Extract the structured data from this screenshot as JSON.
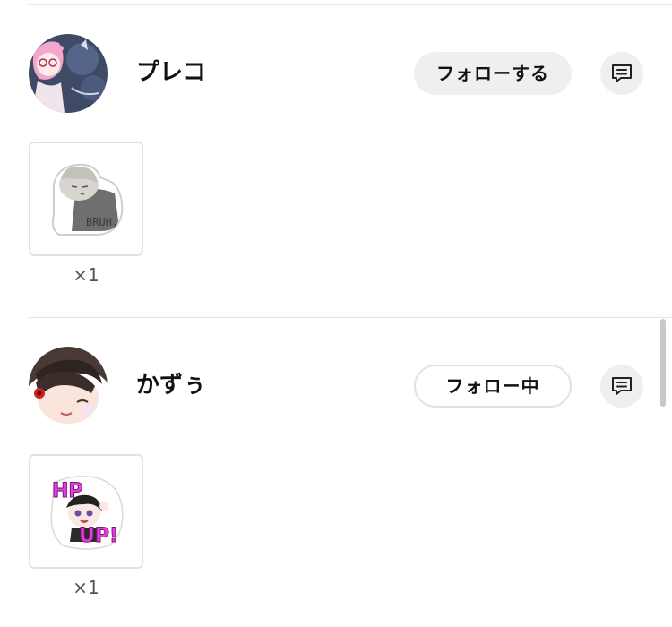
{
  "users": [
    {
      "name": "プレコ",
      "follow_label": "フォローする",
      "follow_state": "not-following",
      "sticker_count": "×1",
      "sticker_icon": "bruh-sticker"
    },
    {
      "name": "かずぅ",
      "follow_label": "フォロー中",
      "follow_state": "following",
      "sticker_count": "×1",
      "sticker_icon": "hp-up-sticker"
    }
  ],
  "icons": {
    "message": "message-icon"
  },
  "colors": {
    "button_bg": "#efefef",
    "border": "#e2e2e2",
    "divider": "#e4e4e4",
    "muted_text": "#555555",
    "sticker_magenta": "#e83be0"
  }
}
